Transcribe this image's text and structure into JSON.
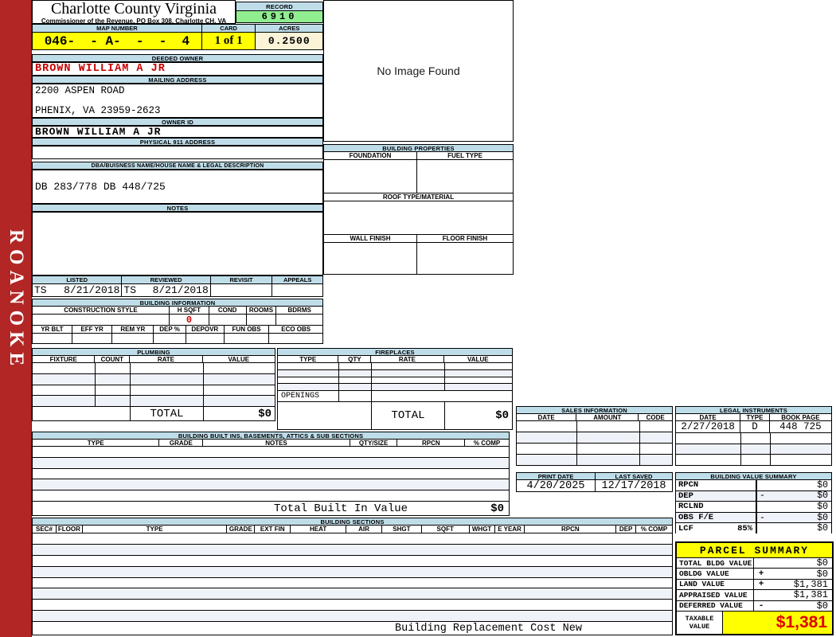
{
  "sidebar": {
    "vertical_text": "ROANOKE"
  },
  "header": {
    "county_title": "Charlotte County Virginia",
    "county_subtitle": "Commissioner of the Revenue, PO Box 308, Charlotte CH, VA",
    "record_label": "RECORD",
    "record_value": "6910",
    "map_number_label": "MAP NUMBER",
    "map_number_value": "046-  - A-  -  -  4",
    "card_label": "CARD",
    "card_value": "1 of 1",
    "acres_label": "ACRES",
    "acres_value": "0.2500"
  },
  "owner": {
    "deeded_owner_label": "DEEDED OWNER",
    "deeded_owner": "BROWN WILLIAM A JR",
    "mailing_address_label": "MAILING ADDRESS",
    "mailing_line1": "2200 ASPEN ROAD",
    "mailing_line2": "PHENIX, VA 23959-2623",
    "owner_id_label": "OWNER ID",
    "owner_id": "BROWN WILLIAM A JR",
    "physical_911_label": "PHYSICAL 911 ADDRESS",
    "physical_911_value": ""
  },
  "description": {
    "dba_label": "DBA/BUISNESS NAME/HOUSE NAME & LEGAL DESCRIPTION",
    "dba_value": "DB 283/778 DB 448/725",
    "notes_label": "NOTES",
    "notes_value": ""
  },
  "visits": {
    "listed_label": "LISTED",
    "listed_by": "TS",
    "listed_date": "8/21/2018",
    "reviewed_label": "REVIEWED",
    "reviewed_by": "TS",
    "reviewed_date": "8/21/2018",
    "revisit_label": "REVISIT",
    "revisit_value": "",
    "appeals_label": "APPEALS",
    "appeals_value": ""
  },
  "image_panel": {
    "no_image_text": "No Image Found"
  },
  "building_properties": {
    "title": "BUILDING PROPERTIES",
    "foundation_label": "FOUNDATION",
    "fuel_type_label": "FUEL TYPE",
    "roof_label": "ROOF TYPE/MATERIAL",
    "wall_finish_label": "WALL FINISH",
    "floor_finish_label": "FLOOR FINISH"
  },
  "building_information": {
    "title": "BUILDING INFORMATION",
    "row1_headers": [
      "CONSTRUCTION STYLE",
      "H SQFT",
      "COND",
      "ROOMS",
      "BDRMS"
    ],
    "h_sqft_value": "0",
    "row2_headers": [
      "YR BLT",
      "EFF YR",
      "REM YR",
      "DEP %",
      "DEPOVR",
      "FUN OBS",
      "ECO OBS"
    ]
  },
  "plumbing": {
    "title": "PLUMBING",
    "headers": [
      "FIXTURE",
      "COUNT",
      "RATE",
      "VALUE"
    ],
    "total_label": "TOTAL",
    "total_value": "$0"
  },
  "fireplaces": {
    "title": "FIREPLACES",
    "headers": [
      "TYPE",
      "QTY",
      "RATE",
      "VALUE"
    ],
    "openings_label": "OPENINGS",
    "total_label": "TOTAL",
    "total_value": "$0"
  },
  "builtins": {
    "title": "BUILDING BUILT INS, BASEMENTS, ATTICS & SUB SECTIONS",
    "headers": [
      "TYPE",
      "GRADE",
      "NOTES",
      "QTY/SIZE",
      "RPCN",
      "% COMP"
    ],
    "total_label": "Total Built In Value",
    "total_value": "$0"
  },
  "building_sections": {
    "title": "BUILDING SECTIONS",
    "headers": [
      "SEC#",
      "FLOOR",
      "TYPE",
      "GRADE",
      "EXT FIN",
      "HEAT",
      "AIR",
      "SHGT",
      "SQFT",
      "WHGT",
      "E YEAR",
      "RPCN",
      "DEP",
      "% COMP"
    ],
    "footer_text": "Building Replacement Cost New"
  },
  "sales": {
    "title": "SALES INFORMATION",
    "headers": [
      "DATE",
      "AMOUNT",
      "CODE"
    ]
  },
  "legal_instruments": {
    "title": "LEGAL INSTRUMENTS",
    "headers": [
      "DATE",
      "TYPE",
      "BOOK PAGE"
    ],
    "row1": {
      "date": "2/27/2018",
      "type": "D",
      "book_page": "448 725"
    }
  },
  "dates": {
    "print_date_label": "PRINT DATE",
    "print_date_value": "4/20/2025",
    "last_saved_label": "LAST SAVED",
    "last_saved_value": "12/17/2018"
  },
  "building_value_summary": {
    "title": "BUILDING VALUE SUMMARY",
    "rows": [
      {
        "label": "RPCN",
        "pct": "",
        "op": "",
        "value": "$0"
      },
      {
        "label": "DEP",
        "pct": "",
        "op": "-",
        "value": "$0"
      },
      {
        "label": "RCLND",
        "pct": "",
        "op": "",
        "value": "$0"
      },
      {
        "label": "OBS F/E",
        "pct": "",
        "op": "-",
        "value": "$0"
      },
      {
        "label": "LCF",
        "pct": "85%",
        "op": "",
        "value": "$0"
      }
    ]
  },
  "parcel_summary": {
    "title": "PARCEL SUMMARY",
    "rows": [
      {
        "label": "TOTAL BLDG VALUE",
        "op": "",
        "value": "$0"
      },
      {
        "label": "OBLDG VALUE",
        "op": "+",
        "value": "$0"
      },
      {
        "label": "LAND VALUE",
        "op": "+",
        "value": "$1,381"
      },
      {
        "label": "APPRAISED VALUE",
        "op": "",
        "value": "$1,381"
      },
      {
        "label": "DEFERRED VALUE",
        "op": "-",
        "value": "$0"
      }
    ],
    "taxable_label_line1": "TAXABLE",
    "taxable_label_line2": "VALUE",
    "taxable_value": "$1,381"
  },
  "colors": {
    "sidebar_red": "#B22626",
    "header_blue": "#BFDDE9",
    "record_green": "#90EE90",
    "highlight_yellow": "#FFFF00",
    "acres_cream": "#FAF3D8",
    "alt_row": "#F0F2FA",
    "alert_red": "#C80000"
  }
}
